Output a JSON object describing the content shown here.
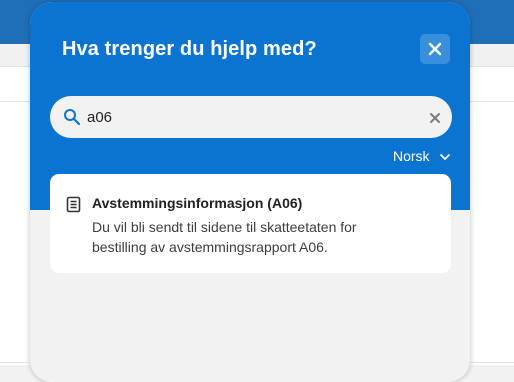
{
  "panel": {
    "title": "Hva trenger du hjelp med?",
    "close_icon": "close-icon"
  },
  "search": {
    "value": "a06",
    "search_icon": "search-icon",
    "clear_icon": "clear-icon"
  },
  "language": {
    "label": "Norsk",
    "icon": "chevron-down-icon"
  },
  "results": [
    {
      "icon": "document-icon",
      "title": "Avstemmingsinformasjon (A06)",
      "description": "Du vil bli sendt til sidene til skatteetaten for bestilling av avstemmingsrapport A06."
    }
  ],
  "colors": {
    "primary": "#0b74d0",
    "topbar": "#1f6fb8",
    "panel_bg": "#f2f2f2",
    "card_bg": "#ffffff"
  }
}
